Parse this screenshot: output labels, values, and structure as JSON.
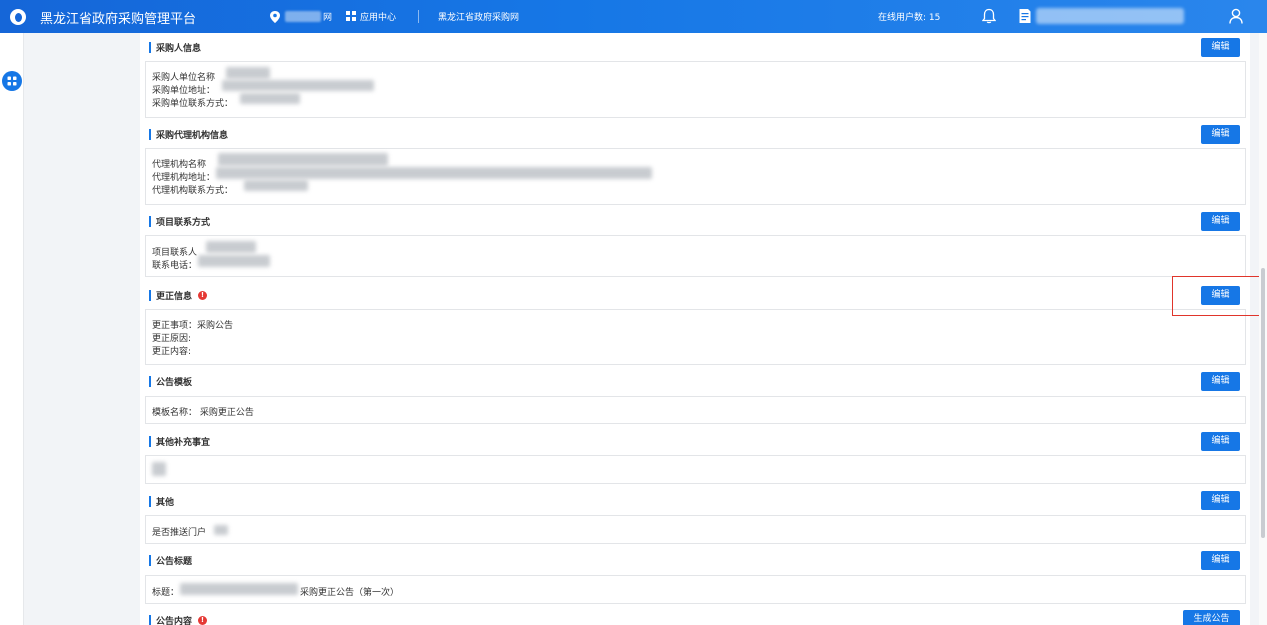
{
  "header": {
    "app_title": "黑龙江省政府采购管理平台",
    "location_suffix": "网",
    "app_center": "应用中心",
    "gov_site": "黑龙江省政府采购网",
    "online_label": "在线用户数: 15",
    "brand_color": "#1677e6"
  },
  "sections": {
    "buyer": {
      "title": "采购人信息",
      "edit": "编辑",
      "lines": [
        "采购人单位名称",
        "采购单位地址：",
        "采购单位联系方式："
      ]
    },
    "agency": {
      "title": "采购代理机构信息",
      "edit": "编辑",
      "lines": [
        "代理机构名称",
        "代理机构地址：",
        "代理机构联系方式："
      ]
    },
    "contact": {
      "title": "项目联系方式",
      "edit": "编辑",
      "lines": [
        "项目联系人",
        "联系电话："
      ]
    },
    "correction": {
      "title": "更正信息",
      "edit": "编辑",
      "lines": [
        "更正事项：采购公告",
        "更正原因:",
        "更正内容:"
      ]
    },
    "template": {
      "title": "公告模板",
      "edit": "编辑",
      "lines": [
        "模板名称：  采购更正公告"
      ]
    },
    "supplement": {
      "title": "其他补充事宜",
      "edit": "编辑"
    },
    "other": {
      "title": "其他",
      "edit": "编辑",
      "lines": [
        "是否推送门户"
      ]
    },
    "notice_title": {
      "title": "公告标题",
      "edit": "编辑",
      "label": "标题：",
      "suffix": "采购更正公告（第一次）"
    },
    "notice_content": {
      "title": "公告内容",
      "generate": "生成公告"
    }
  }
}
